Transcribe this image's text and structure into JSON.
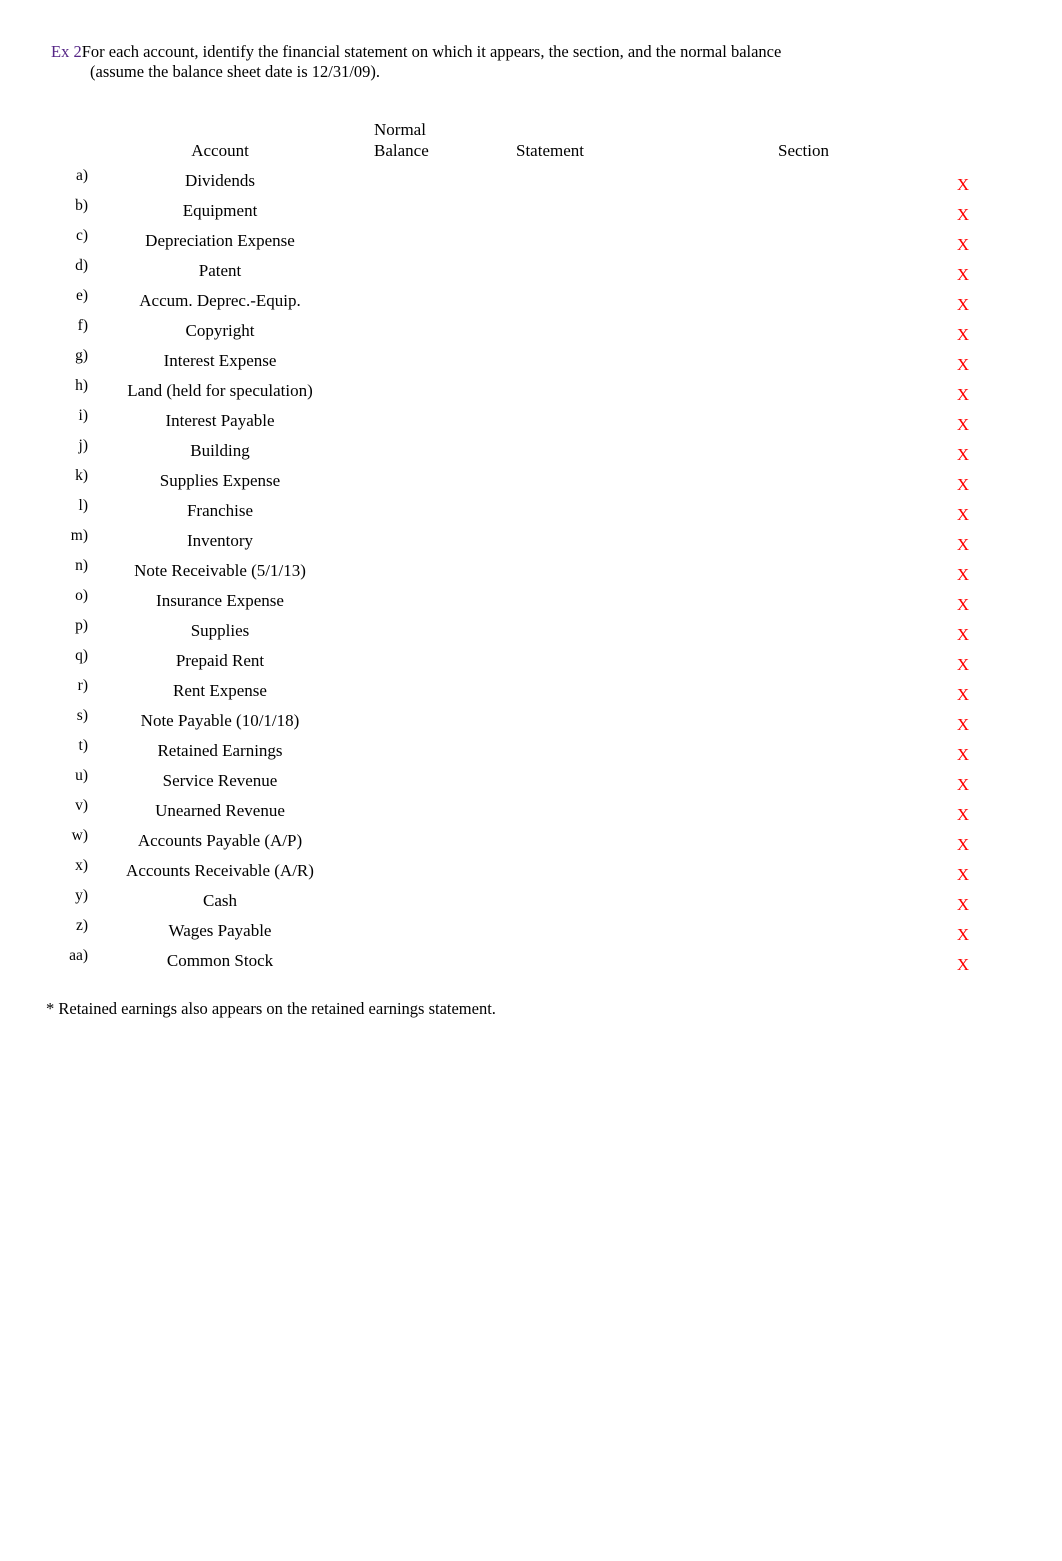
{
  "prompt": {
    "ex_label": "Ex 2",
    "line1": "For each account, identify the financial statement on which it appears, the section, and the normal balance",
    "line2": "(assume the balance sheet date is 12/31/09)."
  },
  "table": {
    "headers": {
      "account": "Account",
      "normal_balance_line1": "Normal",
      "normal_balance_line2": "Balance",
      "statement": "Statement",
      "section": "Section"
    },
    "mark_color": "#ff0000",
    "mark_glyph": "X",
    "rows": [
      {
        "letter": "a)",
        "account": "Dividends",
        "normal_balance": "",
        "statement": "",
        "section": "",
        "mark": "X"
      },
      {
        "letter": "b)",
        "account": "Equipment",
        "normal_balance": "",
        "statement": "",
        "section": "",
        "mark": "X"
      },
      {
        "letter": "c)",
        "account": "Depreciation Expense",
        "normal_balance": "",
        "statement": "",
        "section": "",
        "mark": "X"
      },
      {
        "letter": "d)",
        "account": "Patent",
        "normal_balance": "",
        "statement": "",
        "section": "",
        "mark": "X"
      },
      {
        "letter": "e)",
        "account": "Accum. Deprec.-Equip.",
        "normal_balance": "",
        "statement": "",
        "section": "",
        "mark": "X"
      },
      {
        "letter": "f)",
        "account": "Copyright",
        "normal_balance": "",
        "statement": "",
        "section": "",
        "mark": "X"
      },
      {
        "letter": "g)",
        "account": "Interest Expense",
        "normal_balance": "",
        "statement": "",
        "section": "",
        "mark": "X"
      },
      {
        "letter": "h)",
        "account": "Land (held for speculation)",
        "normal_balance": "",
        "statement": "",
        "section": "",
        "mark": "X"
      },
      {
        "letter": "i)",
        "account": "Interest Payable",
        "normal_balance": "",
        "statement": "",
        "section": "",
        "mark": "X"
      },
      {
        "letter": "j)",
        "account": "Building",
        "normal_balance": "",
        "statement": "",
        "section": "",
        "mark": "X"
      },
      {
        "letter": "k)",
        "account": "Supplies Expense",
        "normal_balance": "",
        "statement": "",
        "section": "",
        "mark": "X"
      },
      {
        "letter": "l)",
        "account": "Franchise",
        "normal_balance": "",
        "statement": "",
        "section": "",
        "mark": "X"
      },
      {
        "letter": "m)",
        "account": "Inventory",
        "normal_balance": "",
        "statement": "",
        "section": "",
        "mark": "X"
      },
      {
        "letter": "n)",
        "account": "Note Receivable (5/1/13)",
        "normal_balance": "",
        "statement": "",
        "section": "",
        "mark": "X"
      },
      {
        "letter": "o)",
        "account": "Insurance Expense",
        "normal_balance": "",
        "statement": "",
        "section": "",
        "mark": "X"
      },
      {
        "letter": "p)",
        "account": "Supplies",
        "normal_balance": "",
        "statement": "",
        "section": "",
        "mark": "X"
      },
      {
        "letter": "q)",
        "account": "Prepaid Rent",
        "normal_balance": "",
        "statement": "",
        "section": "",
        "mark": "X"
      },
      {
        "letter": "r)",
        "account": "Rent Expense",
        "normal_balance": "",
        "statement": "",
        "section": "",
        "mark": "X"
      },
      {
        "letter": "s)",
        "account": "Note Payable (10/1/18)",
        "normal_balance": "",
        "statement": "",
        "section": "",
        "mark": "X"
      },
      {
        "letter": "t)",
        "account": "Retained Earnings",
        "normal_balance": "",
        "statement": "",
        "section": "",
        "mark": "X"
      },
      {
        "letter": "u)",
        "account": "Service Revenue",
        "normal_balance": "",
        "statement": "",
        "section": "",
        "mark": "X"
      },
      {
        "letter": "v)",
        "account": "Unearned Revenue",
        "normal_balance": "",
        "statement": "",
        "section": "",
        "mark": "X"
      },
      {
        "letter": "w)",
        "account": "Accounts Payable (A/P)",
        "normal_balance": "",
        "statement": "",
        "section": "",
        "mark": "X"
      },
      {
        "letter": "x)",
        "account": "Accounts Receivable (A/R)",
        "normal_balance": "",
        "statement": "",
        "section": "",
        "mark": "X"
      },
      {
        "letter": "y)",
        "account": "Cash",
        "normal_balance": "",
        "statement": "",
        "section": "",
        "mark": "X"
      },
      {
        "letter": "z)",
        "account": "Wages Payable",
        "normal_balance": "",
        "statement": "",
        "section": "",
        "mark": "X"
      },
      {
        "letter": "aa)",
        "account": "Common Stock",
        "normal_balance": "",
        "statement": "",
        "section": "",
        "mark": "X"
      }
    ]
  },
  "footnote": "* Retained earnings also appears on the retained earnings statement."
}
